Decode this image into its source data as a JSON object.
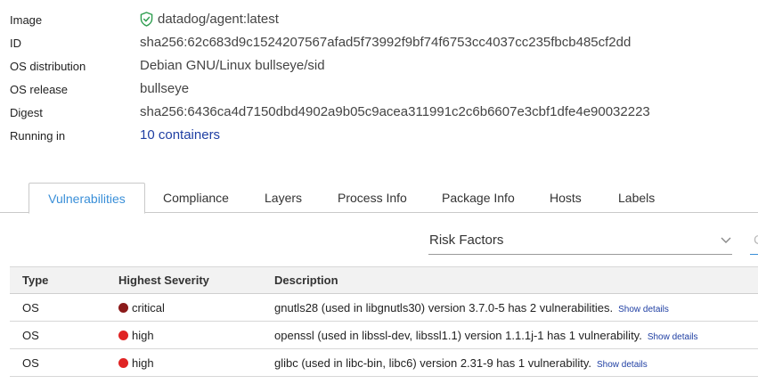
{
  "info": [
    {
      "label": "Image",
      "value": "datadog/agent:latest",
      "icon": "verified-shield-icon",
      "icon_color": "#2e9e4f"
    },
    {
      "label": "ID",
      "value": "sha256:62c683d9c1524207567afad5f73992f9bf74f6753cc4037cc235fbcb485cf2dd"
    },
    {
      "label": "OS distribution",
      "value": "Debian GNU/Linux bullseye/sid"
    },
    {
      "label": "OS release",
      "value": "bullseye"
    },
    {
      "label": "Digest",
      "value": "sha256:6436ca4d7150dbd4902a9b05c9acea311991c2c6b6607e3cbf1dfe4e90032223"
    },
    {
      "label": "Running in",
      "value": "10 containers",
      "link": true
    }
  ],
  "tabs": [
    {
      "label": "Vulnerabilities",
      "active": true
    },
    {
      "label": "Compliance"
    },
    {
      "label": "Layers"
    },
    {
      "label": "Process Info"
    },
    {
      "label": "Package Info"
    },
    {
      "label": "Hosts"
    },
    {
      "label": "Labels"
    }
  ],
  "filter": {
    "label": "Risk Factors",
    "icon": "chevron-down-icon",
    "next_label": "C"
  },
  "table": {
    "headers": [
      "Type",
      "Highest Severity",
      "Description"
    ],
    "rows": [
      {
        "type": "OS",
        "severity": "critical",
        "severity_color": "#8b1a1a",
        "description": "gnutls28 (used in libgnutls30) version 3.7.0-5 has 2 vulnerabilities.",
        "action": "Show details"
      },
      {
        "type": "OS",
        "severity": "high",
        "severity_color": "#e02424",
        "description": "openssl (used in libssl-dev, libssl1.1) version 1.1.1j-1 has 1 vulnerability.",
        "action": "Show details"
      },
      {
        "type": "OS",
        "severity": "high",
        "severity_color": "#e02424",
        "description": "glibc (used in libc-bin, libc6) version 2.31-9 has 1 vulnerability.",
        "action": "Show details"
      }
    ]
  },
  "colors": {
    "accent": "#3a8fd8",
    "link": "#1f3fa3"
  }
}
